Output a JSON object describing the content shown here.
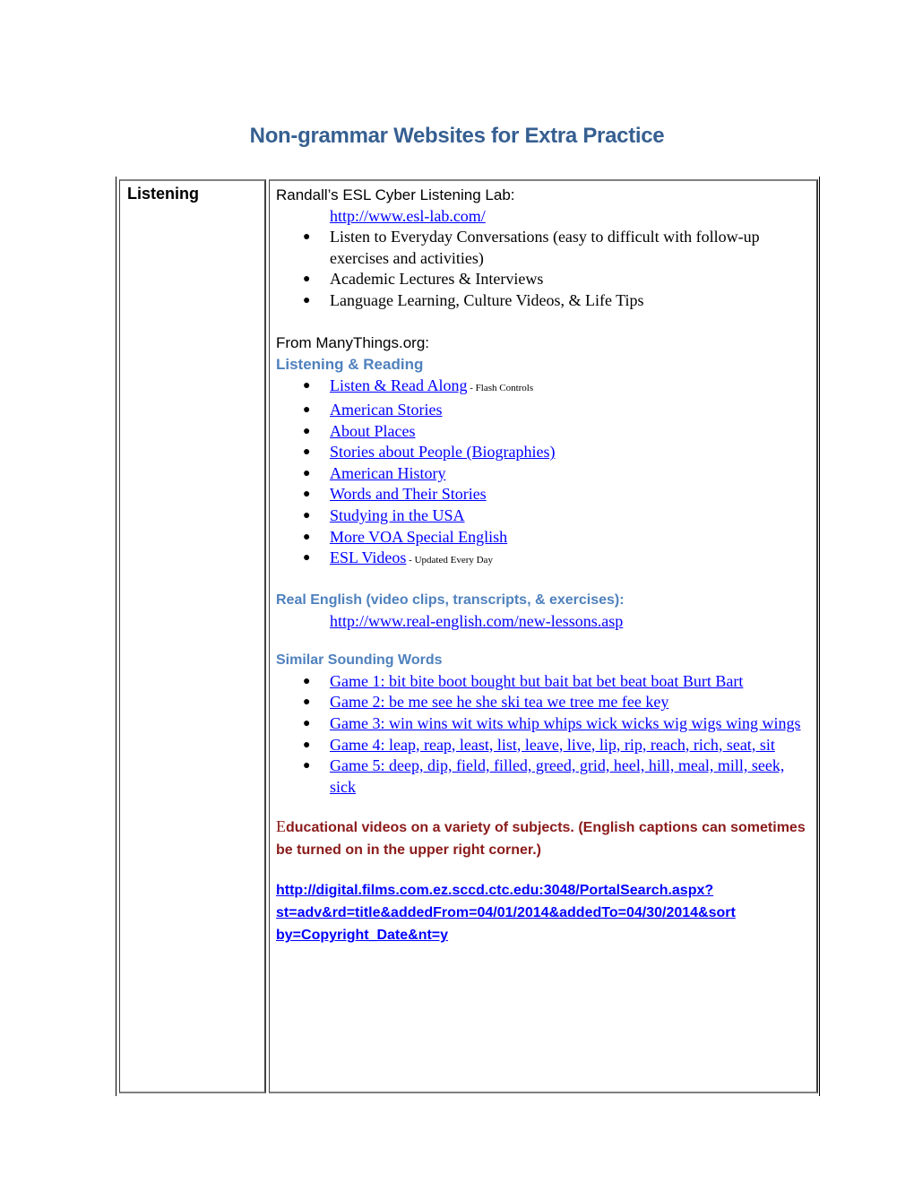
{
  "document": {
    "title": "Non-grammar Websites for Extra Practice"
  },
  "table": {
    "row_label": "Listening",
    "randall": {
      "heading": "Randall’s ESL Cyber Listening Lab:",
      "url": "http://www.esl-lab.com/",
      "items": [
        "Listen to Everyday Conversations (easy to difficult with follow-up exercises and activities)",
        "Academic Lectures & Interviews",
        "Language Learning, Culture Videos, & Life Tips"
      ]
    },
    "manythings": {
      "heading": "From ManyThings.org:",
      "subheading": "Listening & Reading",
      "links": [
        {
          "label": "Listen & Read Along",
          "note": " - Flash Controls"
        },
        {
          "label": "American Stories",
          "note": ""
        },
        {
          "label": "About Places",
          "note": ""
        },
        {
          "label": "Stories about People (Biographies)",
          "note": ""
        },
        {
          "label": "American History",
          "note": ""
        },
        {
          "label": "Words and Their Stories",
          "note": ""
        },
        {
          "label": "Studying in the USA",
          "note": ""
        },
        {
          "label": "More VOA Special English",
          "note": ""
        },
        {
          "label": "ESL Videos",
          "note": " - Updated Every Day"
        }
      ]
    },
    "real_english": {
      "heading": "Real English (video clips, transcripts, & exercises):",
      "url": "http://www.real-english.com/new-lessons.asp"
    },
    "similar_sounding": {
      "heading": "Similar Sounding Words",
      "links": [
        "Game 1: bit bite boot bought but bait bat bet beat boat Burt Bart",
        "Game 2: be me see he she ski tea we tree me fee key",
        "Game 3: win wins wit wits whip whips wick wicks wig wigs wing wings",
        "Game 4: leap, reap, least, list, leave, live, lip, rip, reach, rich, seat, sit",
        "Game 5: deep, dip, field, filled, greed, grid, heel, hill, meal, mill, seek, sick"
      ]
    },
    "educational": {
      "first_letter": "E",
      "text": "ducational videos on a variety of subjects. (English captions can sometimes be turned on in the upper right corner.)",
      "url_line1": "http://digital.films.com.ez.sccd.ctc.edu:3048/PortalSearch.aspx?",
      "url_line2": "st=adv&rd=title&addedFrom=04/01/2014&addedTo=04/30/2014&sort",
      "url_line3": "by=Copyright_Date&nt=y"
    },
    "colors": {
      "title": "#365f91",
      "subheading_blue": "#4f81bd",
      "link": "#0000ff",
      "dark_red": "#8b1a1a"
    }
  }
}
